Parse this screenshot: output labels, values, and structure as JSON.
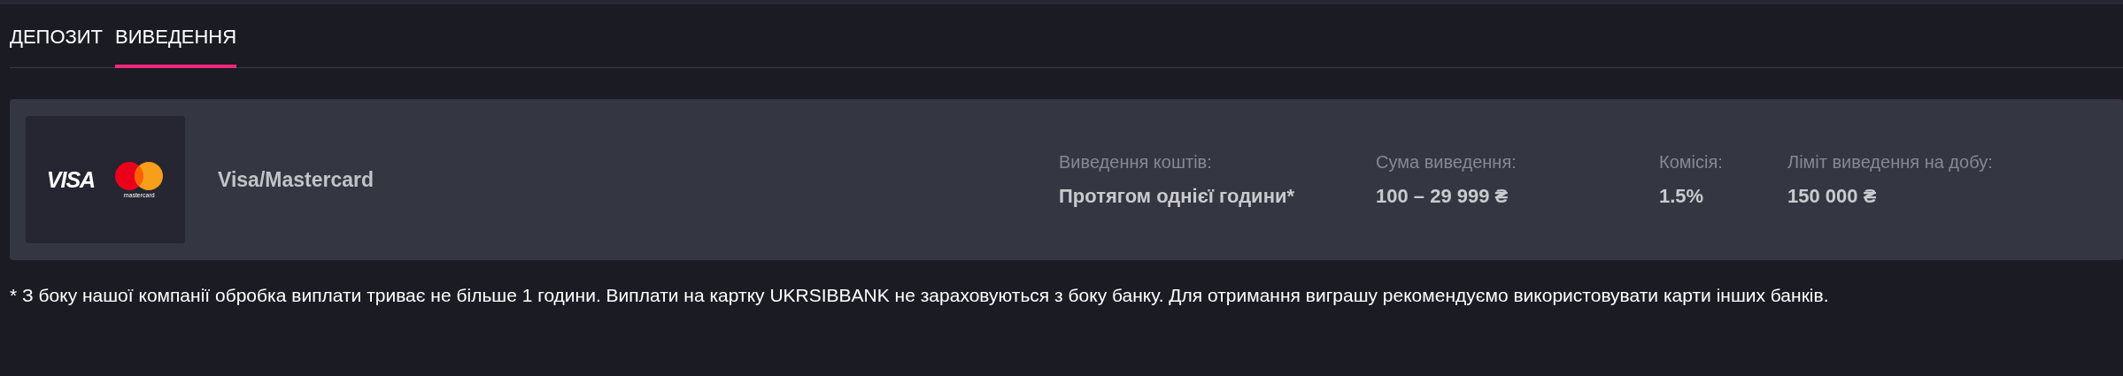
{
  "tabs": [
    {
      "label": "ДЕПОЗИТ",
      "selected": false
    },
    {
      "label": "ВИВЕДЕННЯ",
      "selected": true
    }
  ],
  "methods": [
    {
      "logo": {
        "visa": "VISA",
        "mastercard": "mastercard"
      },
      "name": "Visa/Mastercard",
      "details": [
        {
          "label": "Виведення коштів:",
          "value": "Протягом однієї години*"
        },
        {
          "label": "Сума виведення:",
          "value": "100 – 29 999 ₴"
        },
        {
          "label": "Комісія:",
          "value": "1.5%"
        },
        {
          "label": "Ліміт виведення на добу:",
          "value": "150 000 ₴"
        }
      ]
    }
  ],
  "note": "* З боку нашої компанії обробка виплати триває не більше 1 години. Виплати на картку UKRSIBBANK не зараховуються з боку банку. Для отримання виграшу рекомендуємо використовувати карти інших банків."
}
